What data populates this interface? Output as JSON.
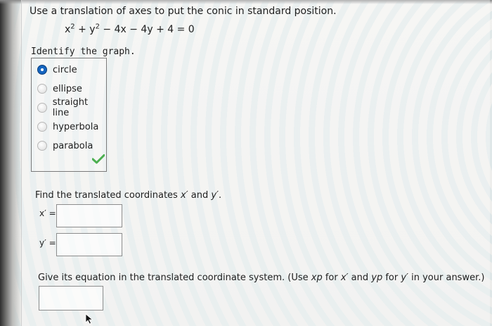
{
  "question": {
    "prompt": "Use a translation of axes to put the conic in standard position.",
    "equation": {
      "t1": "x",
      "e1": "2",
      "t2": " + y",
      "e2": "2",
      "t3": " − 4x − 4y + 4 = 0"
    },
    "identify_label": "Identify the graph."
  },
  "choices": [
    {
      "label": "circle",
      "selected": true
    },
    {
      "label": "ellipse",
      "selected": false
    },
    {
      "label": "straight line",
      "selected": false
    },
    {
      "label": "hyperbola",
      "selected": false
    },
    {
      "label": "parabola",
      "selected": false
    }
  ],
  "translated": {
    "prompt_pre": "Find the translated coordinates ",
    "xvar": "x′",
    "mid": " and ",
    "yvar": "y′",
    "end": ".",
    "x_label": "x′ =",
    "y_label": "y′ =",
    "x_value": "",
    "y_value": ""
  },
  "equation_answer": {
    "prompt_pre": "Give its equation in the translated coordinate system. (Use ",
    "xp": "xp",
    "for1": " for ",
    "xprime": "x′",
    "and": " and ",
    "yp": "yp",
    "for2": " for ",
    "yprime": "y′",
    "tail": " in your answer.)",
    "value": ""
  },
  "colors": {
    "selected_radio": "#1565c0",
    "check": "#4caf50"
  },
  "icons": {
    "correct": "check-icon",
    "pointer": "mouse-cursor-icon"
  }
}
